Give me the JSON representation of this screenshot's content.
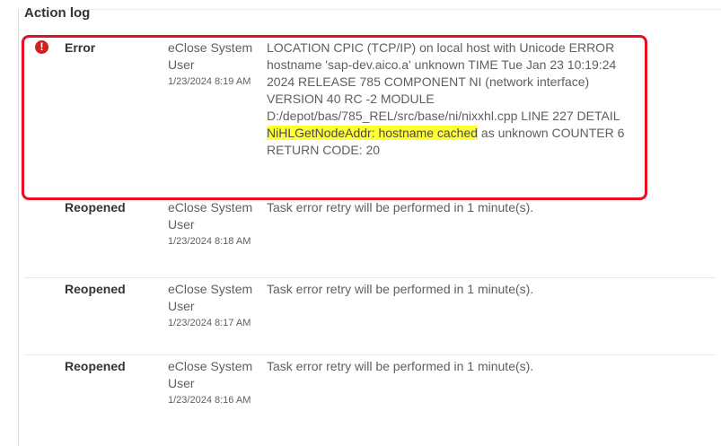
{
  "panel": {
    "title": "Action log"
  },
  "entries": [
    {
      "status": "Error",
      "icon": "error-icon",
      "icon_glyph": "!",
      "user": "eClose System User",
      "date": "1/23/2024 8:19 AM",
      "message_before": "LOCATION CPIC (TCP/IP) on local host with Unicode ERROR hostname 'sap-dev.aico.a' unknown TIME Tue Jan 23 10:19:24 2024 RELEASE 785 COMPONENT NI (network interface) VERSION 40 RC -2 MODULE D:/depot/bas/785_REL/src/base/ni/nixxhl.cpp LINE 227 DETAIL ",
      "message_highlight": "NiHLGetNodeAddr: hostname cached",
      "message_after": " as unknown COUNTER 6 RETURN CODE: 20"
    },
    {
      "status": "Reopened",
      "user": "eClose System User",
      "date": "1/23/2024 8:18 AM",
      "message": "Task error retry will be performed in 1 minute(s)."
    },
    {
      "status": "Reopened",
      "user": "eClose System User",
      "date": "1/23/2024 8:17 AM",
      "message": "Task error retry will be performed in 1 minute(s)."
    },
    {
      "status": "Reopened",
      "user": "eClose System User",
      "date": "1/23/2024 8:16 AM",
      "message": "Task error retry will be performed in 1 minute(s)."
    }
  ],
  "colors": {
    "error_icon": "#d21f1f",
    "annotation_frame": "#e8101e",
    "highlight": "#ffff33"
  }
}
